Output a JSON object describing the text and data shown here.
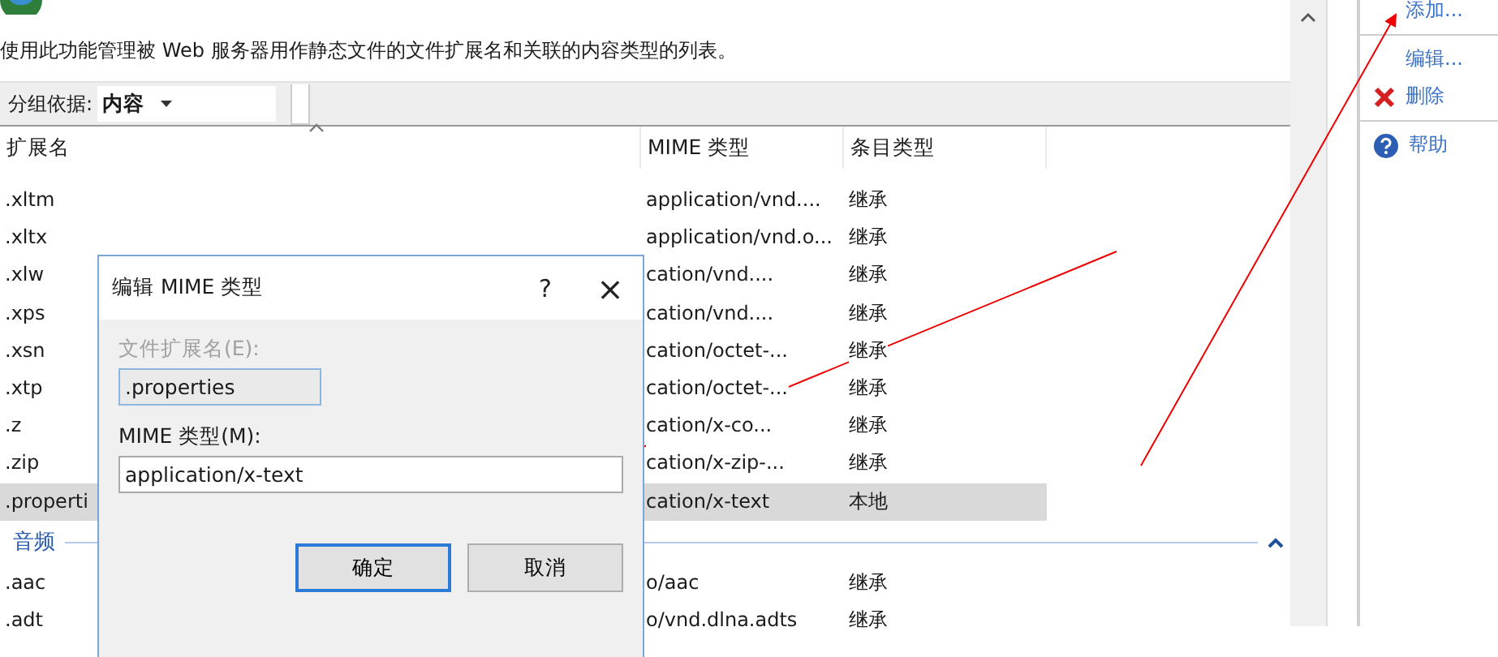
{
  "header": {
    "description": "使用此功能管理被 Web 服务器用作静态文件的文件扩展名和关联的内容类型的列表。"
  },
  "toolbar": {
    "group_by_label": "分组依据:",
    "group_by_value": "内容"
  },
  "list": {
    "columns": [
      "扩展名",
      "MIME 类型",
      "条目类型"
    ],
    "groups": [
      {
        "rows": [
          {
            "extension": ".xltm",
            "mime": "application/vnd....",
            "type": "继承",
            "selected": false
          },
          {
            "extension": ".xltx",
            "mime": "application/vnd.o...",
            "type": "继承",
            "selected": false
          },
          {
            "extension": ".xlw",
            "mime": "cation/vnd....",
            "type": "继承",
            "selected": false
          },
          {
            "extension": ".xps",
            "mime": "cation/vnd....",
            "type": "继承",
            "selected": false
          },
          {
            "extension": ".xsn",
            "mime": "cation/octet-...",
            "type": "继承",
            "selected": false
          },
          {
            "extension": ".xtp",
            "mime": "cation/octet-...",
            "type": "继承",
            "selected": false
          },
          {
            "extension": ".z",
            "mime": "cation/x-co...",
            "type": "继承",
            "selected": false
          },
          {
            "extension": ".zip",
            "mime": "cation/x-zip-...",
            "type": "继承",
            "selected": false
          },
          {
            "extension": ".properti",
            "mime": "cation/x-text",
            "type": "本地",
            "selected": true
          }
        ]
      },
      {
        "label": "音频",
        "expanded": true,
        "rows": [
          {
            "extension": ".aac",
            "mime": "o/aac",
            "type": "继承",
            "selected": false
          },
          {
            "extension": ".adt",
            "mime": "o/vnd.dlna.adts",
            "type": "继承",
            "selected": false
          }
        ]
      }
    ]
  },
  "actions": [
    {
      "label": "添加...",
      "kind": "text",
      "separator_after": true
    },
    {
      "label": "编辑...",
      "kind": "text",
      "separator_after": false
    },
    {
      "label": "删除",
      "kind": "delete",
      "separator_after": true
    },
    {
      "label": "帮助",
      "kind": "help",
      "separator_after": false
    }
  ],
  "dialog": {
    "title": "编辑 MIME 类型",
    "help": "?",
    "close": "×",
    "fields": [
      {
        "label": "文件扩展名(E):",
        "value": ".properties",
        "disabled": true
      },
      {
        "label": "MIME 类型(M):",
        "value": "application/x-text",
        "disabled": false
      }
    ],
    "buttons": [
      {
        "label": "确定",
        "default": true
      },
      {
        "label": "取消",
        "default": false
      }
    ]
  }
}
